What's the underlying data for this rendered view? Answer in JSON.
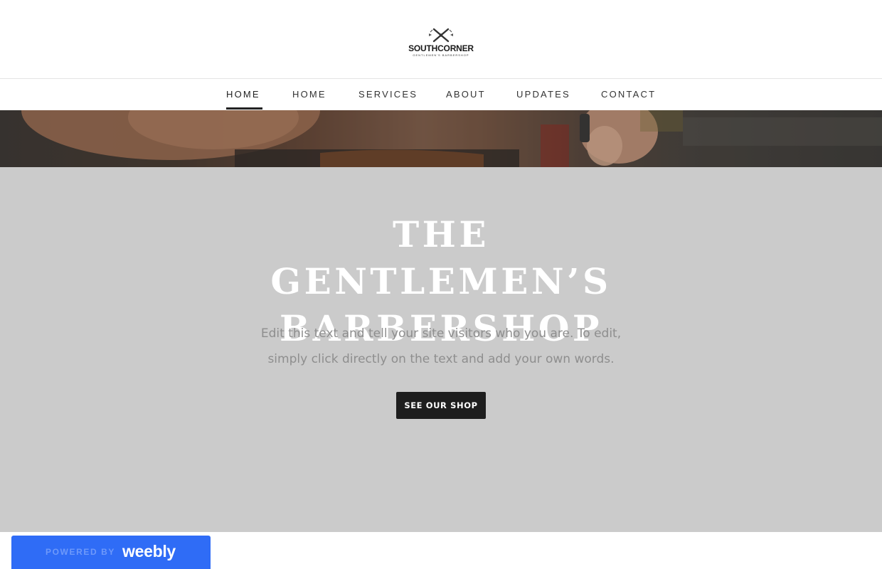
{
  "header": {
    "logo": {
      "name": "SOUTHCORNER",
      "tagline": "GENTLEMEN'S BARBERSHOP",
      "icon": "crossed-razors-icon"
    }
  },
  "nav": {
    "items": [
      {
        "label": "HOME",
        "active": true
      },
      {
        "label": "HOME",
        "active": false
      },
      {
        "label": "SERVICES",
        "active": false
      },
      {
        "label": "ABOUT",
        "active": false
      },
      {
        "label": "UPDATES",
        "active": false
      },
      {
        "label": "CONTACT",
        "active": false
      }
    ]
  },
  "hero": {
    "title_line1": "THE GENTLEMEN’S",
    "title_line2": "BARBERSHOP",
    "text_line1": "Edit this text and tell your site visitors who you are. To edit,",
    "text_line2": "simply click directly on the text and add your own words.",
    "button_label": "SEE OUR SHOP"
  },
  "badge": {
    "powered_by": "POWERED BY",
    "brand": "weebly"
  },
  "colors": {
    "hero_background": "#cbcbcb",
    "button_background": "#1e1e1e",
    "badge_background": "#2f6cf6",
    "nav_text": "#333333"
  }
}
